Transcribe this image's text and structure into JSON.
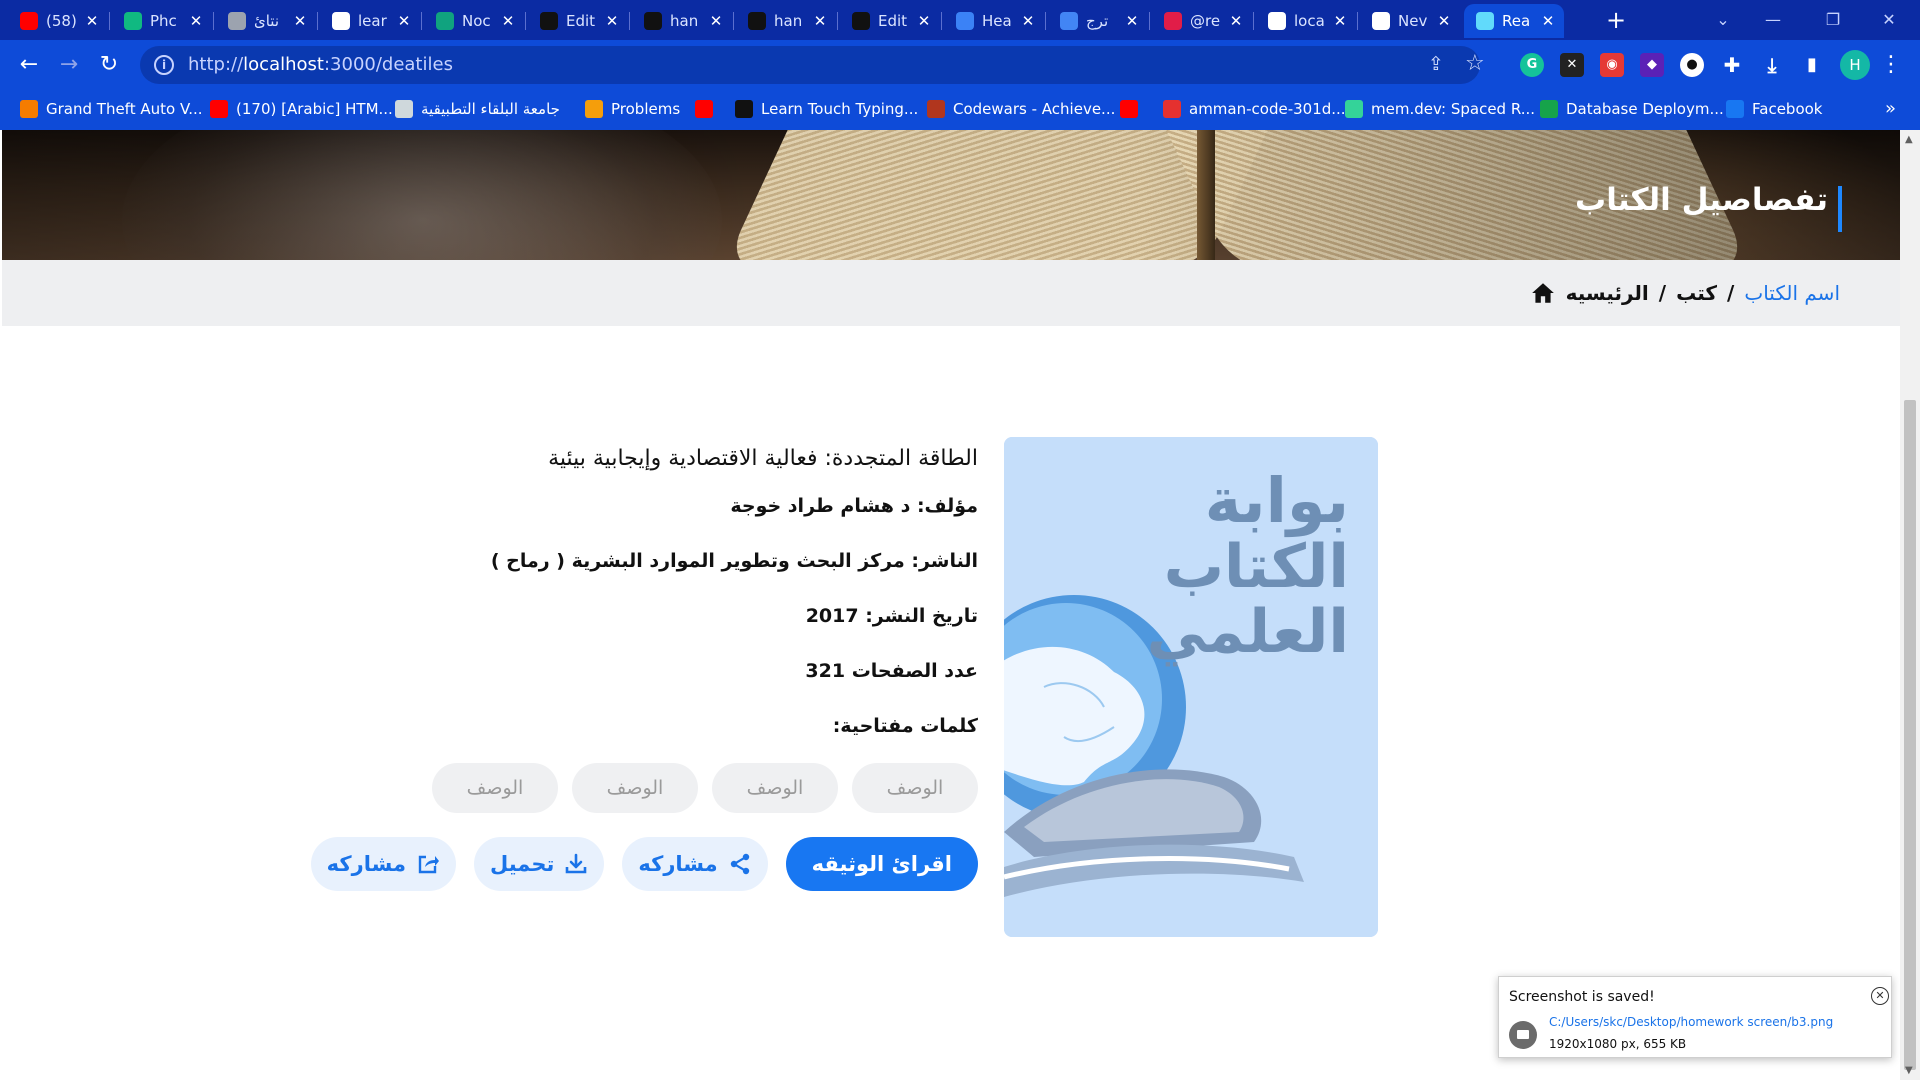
{
  "browser": {
    "tabs": [
      {
        "title": "(58)",
        "favicon": "youtube-icon",
        "color": "#ff0000",
        "active": false
      },
      {
        "title": "Phc",
        "favicon": "phone-app-icon",
        "color": "#10b981",
        "active": false
      },
      {
        "title": "نتائ",
        "favicon": "cloud-icon",
        "color": "#9ca3af",
        "active": false
      },
      {
        "title": "lear",
        "favicon": "globe-icon",
        "color": "#ffffff",
        "active": false
      },
      {
        "title": "Noc",
        "favicon": "chatgpt-icon",
        "color": "#10a37f",
        "active": false
      },
      {
        "title": "Edit",
        "favicon": "github-icon",
        "color": "#111111",
        "active": false
      },
      {
        "title": "han",
        "favicon": "github-icon",
        "color": "#111111",
        "active": false
      },
      {
        "title": "han",
        "favicon": "github-icon",
        "color": "#111111",
        "active": false
      },
      {
        "title": "Edit",
        "favicon": "github-icon",
        "color": "#111111",
        "active": false
      },
      {
        "title": "Hea",
        "favicon": "flag-icon",
        "color": "#3b82f6",
        "active": false
      },
      {
        "title": "ترج",
        "favicon": "translate-icon",
        "color": "#4285f4",
        "active": false
      },
      {
        "title": "@re",
        "favicon": "pinterest-icon",
        "color": "#e11d48",
        "active": false
      },
      {
        "title": "loca",
        "favicon": "globe-icon",
        "color": "#ffffff",
        "active": false
      },
      {
        "title": "Nev",
        "favicon": "chrome-icon",
        "color": "#ffffff",
        "active": false
      },
      {
        "title": "Rea",
        "favicon": "react-icon",
        "color": "#61dafb",
        "active": true
      }
    ],
    "url_prefix": "http://",
    "url_host": "localhost",
    "url_rest": ":3000/deatiles",
    "profile_initial": "H",
    "bookmarks": [
      {
        "label": "Grand Theft Auto V...",
        "icon": "blogger-icon",
        "color": "#f57c00"
      },
      {
        "label": "(170) [Arabic] HTM...",
        "icon": "youtube-icon",
        "color": "#ff0000"
      },
      {
        "label": "جامعة البلقاء التطبيقية",
        "icon": "university-icon",
        "color": "#cfd8dc"
      },
      {
        "label": "Problems",
        "icon": "code-icon",
        "color": "#f59e0b"
      },
      {
        "label": "",
        "icon": "youtube-icon",
        "color": "#ff0000"
      },
      {
        "label": "Learn Touch Typing...",
        "icon": "typing-icon",
        "color": "#111111"
      },
      {
        "label": "Codewars - Achieve...",
        "icon": "codewars-icon",
        "color": "#b1361e"
      },
      {
        "label": "",
        "icon": "youtube-icon",
        "color": "#ff0000"
      },
      {
        "label": "amman-code-301d...",
        "icon": "canvas-icon",
        "color": "#e5312f"
      },
      {
        "label": "mem.dev: Spaced R...",
        "icon": "memdev-icon",
        "color": "#34d399"
      },
      {
        "label": "Database Deploym...",
        "icon": "mongodb-icon",
        "color": "#16a34a"
      },
      {
        "label": "Facebook",
        "icon": "facebook-icon",
        "color": "#1877f2"
      }
    ]
  },
  "page": {
    "hero_title": "تفصاصيل الكتاب",
    "breadcrumb": {
      "home": "الرئيسيه",
      "sep": "/",
      "books": "كتب",
      "current": "اسم الكتاب"
    },
    "cover": {
      "alt_text": "بوابة الكتاب العلمي",
      "line1": "بوابة",
      "line2": "الكتاب",
      "line3": "العلمي"
    },
    "book": {
      "title": "الطاقة المتجددة: فعالية الاقتصادية وإيجابية بيئية",
      "author": "مؤلف: د هشام طراد خوجة",
      "publisher": "الناشر: مركز البحث وتطوير الموارد البشرية ( رماح )",
      "date": "تاريخ النشر: 2017",
      "pages": "عدد الصفحات 321",
      "keywords_label": "كلمات مفتاحية:",
      "keywords": [
        "الوصف",
        "الوصف",
        "الوصف",
        "الوصف"
      ]
    },
    "actions": {
      "read": "اقرائ الوثيقه",
      "share1": "مشاركه",
      "download": "تحميل",
      "share2": "مشاركه"
    },
    "colors": {
      "accent": "#1877f2",
      "accent_soft": "#e8f1fd",
      "breadcrumb_bg": "#eeeff1"
    }
  },
  "toast": {
    "title": "Screenshot is saved!",
    "path": "C:/Users/skc/Desktop/homework screen/b3.png",
    "meta": "1920x1080 px, 655 KB"
  }
}
